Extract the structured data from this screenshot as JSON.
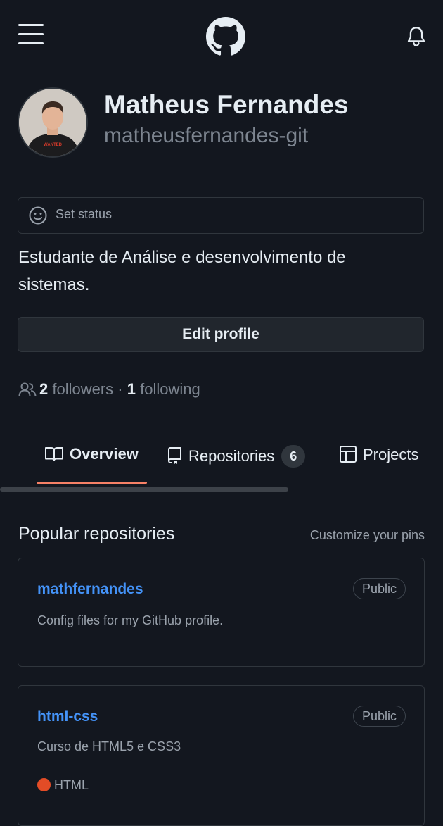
{
  "header": {
    "menu_icon": "hamburger-icon",
    "logo_icon": "github-mark-icon",
    "notifications_icon": "bell-icon"
  },
  "profile": {
    "name": "Matheus Fernandes",
    "login": "matheusfernandes-git",
    "status_label": "Set status",
    "bio": "Estudante de Análise e desenvolvimento de sistemas.",
    "edit_label": "Edit profile",
    "followers_count": "2",
    "followers_label": " followers",
    "separator": " · ",
    "following_count": "1",
    "following_label": " following",
    "avatar_shirt_text": "WANTED"
  },
  "tabs": [
    {
      "label": "Overview",
      "icon": "book-icon",
      "active": true
    },
    {
      "label": "Repositories",
      "icon": "repo-icon",
      "count": "6"
    },
    {
      "label": "Projects",
      "icon": "table-icon"
    }
  ],
  "popular": {
    "title": "Popular repositories",
    "customize_label": "Customize your pins",
    "repos": [
      {
        "name": "mathfernandes",
        "visibility": "Public",
        "description": "Config files for my GitHub profile."
      },
      {
        "name": "html-css",
        "visibility": "Public",
        "description": "Curso de HTML5 e CSS3",
        "language": "HTML",
        "language_color": "#e34c26"
      }
    ]
  },
  "colors": {
    "background": "#13171f",
    "link": "#4493f8",
    "tab_underline": "#f78166",
    "border": "#30363d"
  }
}
